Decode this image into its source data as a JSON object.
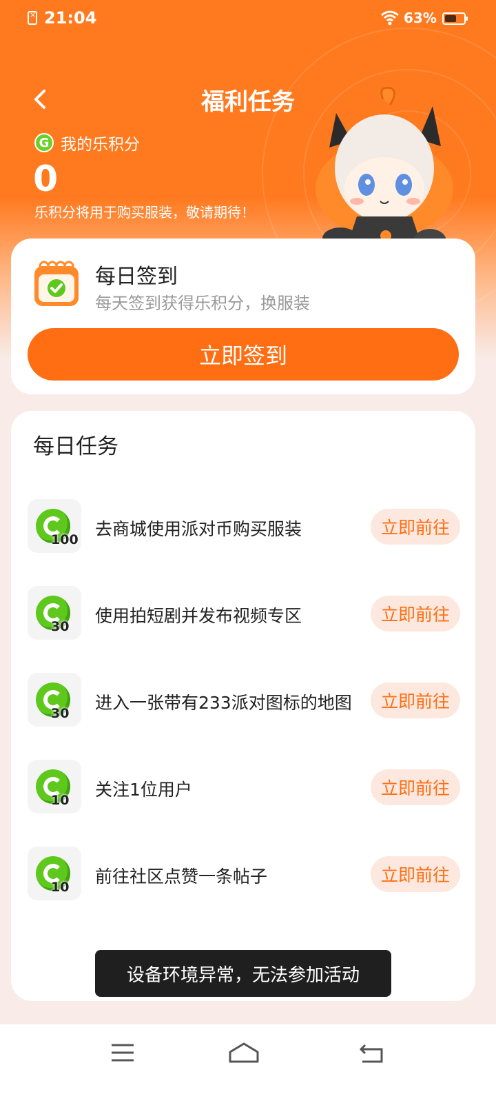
{
  "status_bar": {
    "time": "21:04",
    "battery_percent": "63%",
    "battery_level": 0.63,
    "icons": [
      "sim-error-icon",
      "wifi-icon",
      "battery-icon"
    ]
  },
  "header": {
    "title": "福利任务",
    "back_icon": "chevron-left-icon"
  },
  "points": {
    "label": "我的乐积分",
    "value": "0",
    "note": "乐积分将用于购买服装，敬请期待！"
  },
  "checkin": {
    "title": "每日签到",
    "subtitle": "每天签到获得乐积分，换服装",
    "button": "立即签到"
  },
  "tasks": {
    "title": "每日任务",
    "items": [
      {
        "label": "去商城使用派对币购买服装",
        "reward": "100",
        "button": "立即前往"
      },
      {
        "label": "使用拍短剧并发布视频专区",
        "reward": "30",
        "button": "立即前往"
      },
      {
        "label": "进入一张带有233派对图标的地图",
        "reward": "30",
        "button": "立即前往"
      },
      {
        "label": "关注1位用户",
        "reward": "10",
        "button": "立即前往"
      },
      {
        "label": "前往社区点赞一条帖子",
        "reward": "10",
        "button": "立即前往"
      }
    ]
  },
  "toast": {
    "text": "设备环境异常，无法参加活动"
  },
  "navbar": {
    "icons": [
      "menu-icon",
      "home-icon",
      "back-nav-icon"
    ]
  },
  "colors": {
    "accent": "#ff6e12",
    "hero": "#ff7a1f",
    "coin_green": "#5fc81d",
    "task_button_bg": "#fde8df",
    "page_bg": "#f8ebe8"
  }
}
